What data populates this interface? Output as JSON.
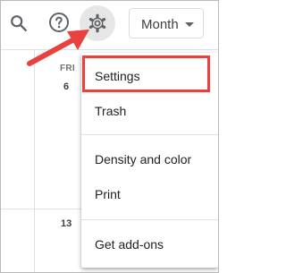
{
  "toolbar": {
    "search_icon": "search-icon",
    "help_icon": "help-icon",
    "settings_icon": "gear-icon",
    "view_selector": {
      "value": "Month",
      "icon": "caret-down-icon"
    }
  },
  "calendar": {
    "day_name": "FRI",
    "dates": [
      "6",
      "13"
    ]
  },
  "menu": {
    "items": [
      {
        "label": "Settings",
        "highlighted": true
      },
      {
        "label": "Trash"
      },
      {
        "label": "Density and color"
      },
      {
        "label": "Print"
      },
      {
        "label": "Get add-ons"
      }
    ]
  },
  "annotation": {
    "highlight_color": "#e8413e",
    "arrow_color": "#e8413e",
    "arrow_icon": "arrow-icon"
  },
  "colors": {
    "gear_button_bg": "#e6e6e6",
    "text_primary": "#202124",
    "text_secondary": "#70757a"
  }
}
